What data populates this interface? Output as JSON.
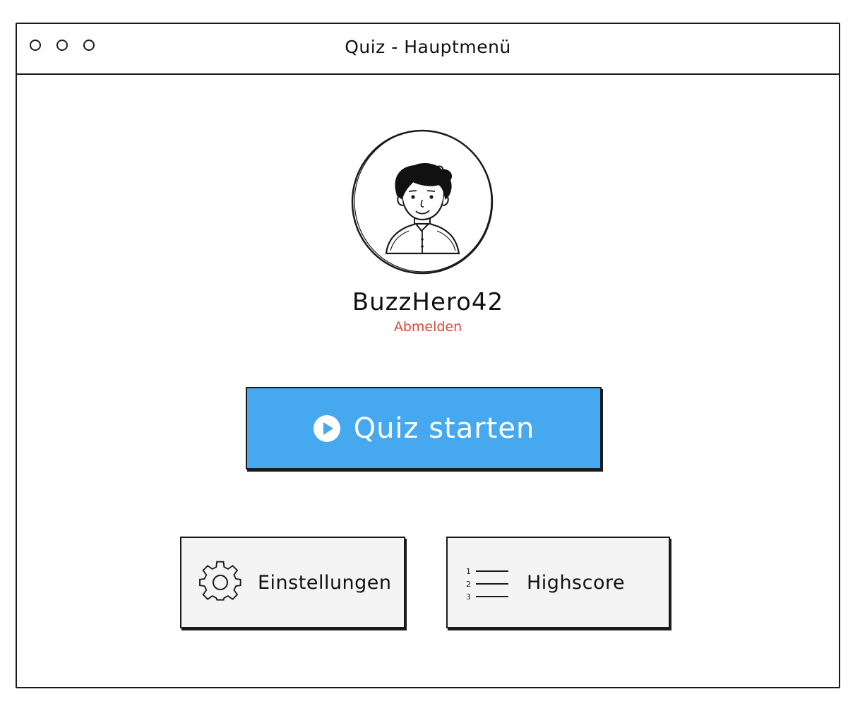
{
  "window": {
    "title": "Quiz - Hauptmenü",
    "controls": [
      "window-dot",
      "window-dot",
      "window-dot"
    ]
  },
  "profile": {
    "avatar_icon": "user-avatar-icon",
    "username": "BuzzHero42",
    "logout_label": "Abmelden",
    "logout_color": "#e0453a"
  },
  "actions": {
    "start": {
      "label": "Quiz starten",
      "icon": "play-icon",
      "background": "#46a8ef",
      "text_color": "#ffffff"
    },
    "settings": {
      "label": "Einstellungen",
      "icon": "gear-icon"
    },
    "highscore": {
      "label": "Highscore",
      "icon": "ranked-list-icon",
      "list_numbers": [
        "1",
        "2",
        "3"
      ]
    }
  }
}
